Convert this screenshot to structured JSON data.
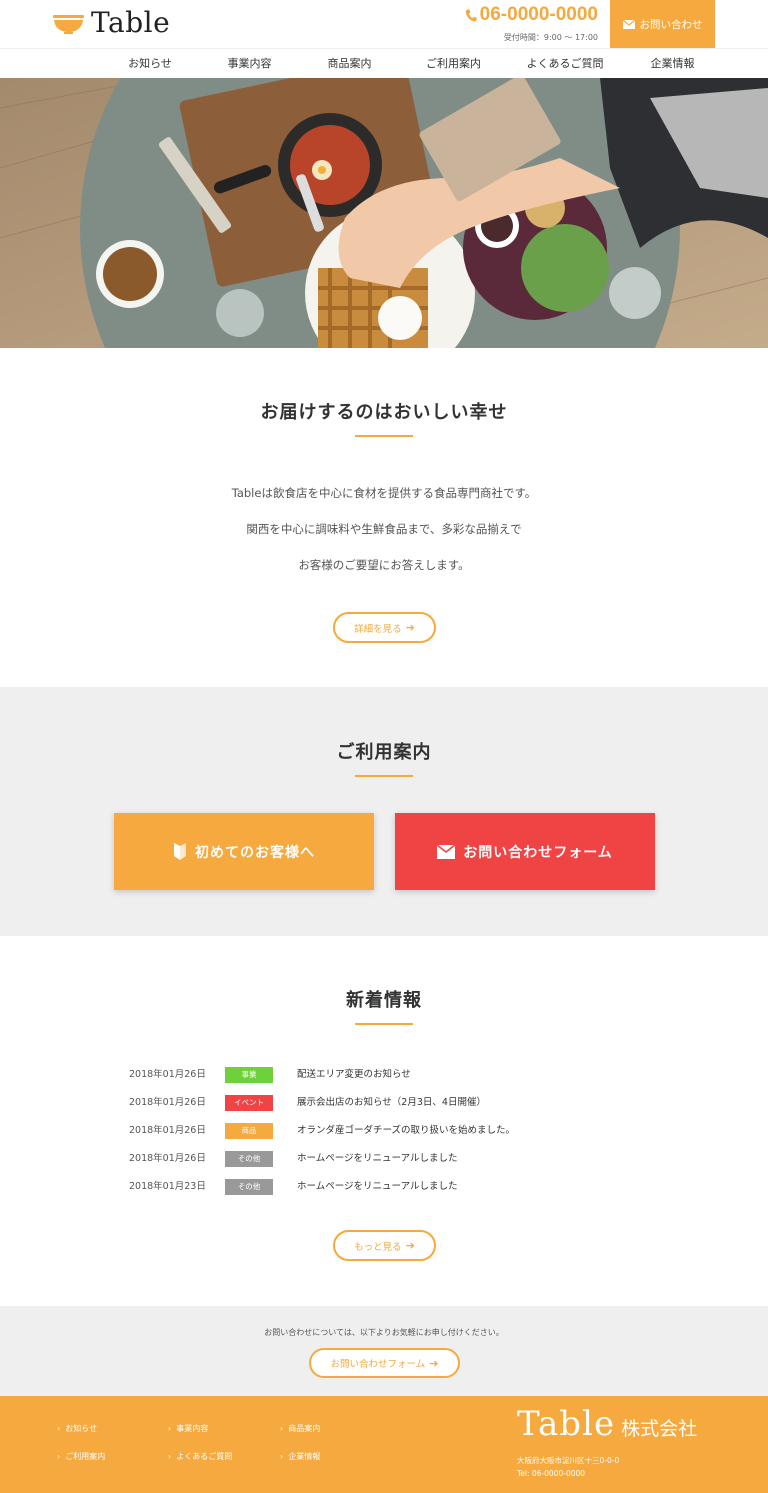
{
  "header": {
    "logo_text": "Table",
    "phone_number": "06-0000-0000",
    "hours": "受付時間：9:00 〜 17:00",
    "contact_label": "お問い合わせ"
  },
  "nav": {
    "items": [
      "お知らせ",
      "事業内容",
      "商品案内",
      "ご利用案内",
      "よくあるご質問",
      "企業情報"
    ]
  },
  "about": {
    "title": "お届けするのはおいしい幸せ",
    "lines": [
      "Tableは飲食店を中心に食材を提供する食品専門商社です。",
      "関西を中心に調味料や生鮮食品まで、多彩な品揃えで",
      "お客様のご要望にお答えします。"
    ],
    "button": "詳細を見る"
  },
  "guide": {
    "title": "ご利用案内",
    "first_button": "初めてのお客様へ",
    "form_button": "お問い合わせフォーム"
  },
  "news": {
    "title": "新着情報",
    "items": [
      {
        "date": "2018年01月26日",
        "tag": "事業",
        "tag_color": "#6fd13a",
        "title": "配送エリア変更のお知らせ"
      },
      {
        "date": "2018年01月26日",
        "tag": "イベント",
        "tag_color": "#f04344",
        "title": "展示会出店のお知らせ（2月3日、4日開催）"
      },
      {
        "date": "2018年01月26日",
        "tag": "商品",
        "tag_color": "#f5a93e",
        "title": "オランダ産ゴーダチーズの取り扱いを始めました。"
      },
      {
        "date": "2018年01月26日",
        "tag": "その他",
        "tag_color": "#999999",
        "title": "ホームページをリニューアルしました"
      },
      {
        "date": "2018年01月23日",
        "tag": "その他",
        "tag_color": "#999999",
        "title": "ホームページをリニューアルしました"
      }
    ],
    "more_button": "もっと見る"
  },
  "contact_strip": {
    "text": "お問い合わせについては、以下よりお気軽にお申し付けください。",
    "button": "お問い合わせフォーム"
  },
  "footer": {
    "links": [
      "お知らせ",
      "事業内容",
      "商品案内",
      "ご利用案内",
      "よくあるご質問",
      "企業情報"
    ],
    "brand_logo": "Table",
    "brand_suffix": "株式会社",
    "address": "大阪府大阪市淀川区十三0-0-0",
    "tel": "Tel: 06-0000-0000"
  },
  "colors": {
    "accent": "#f5a93e",
    "danger": "#f04344"
  }
}
